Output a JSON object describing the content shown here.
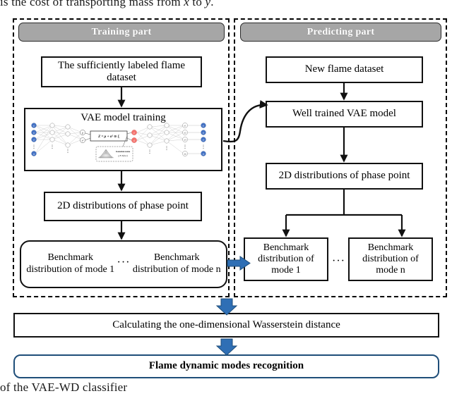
{
  "page": {
    "top_cropped_text_before": "is the cost of transporting mass from ",
    "top_cropped_math_x": "x",
    "top_cropped_text_middle": " to ",
    "top_cropped_math_y": "y",
    "top_cropped_text_after": ".",
    "bottom_cropped_caption": "of the VAE-WD classifier"
  },
  "colors": {
    "header_gray": "#a6a6a6",
    "header_text": "#ffffff",
    "box_border": "#111111",
    "accent_blue": "#2f6fb5",
    "navy_border": "#1f4e79",
    "node_blue": "#4472c4",
    "node_red": "#f4736e"
  },
  "training": {
    "header": "Training part",
    "boxes": {
      "dataset": "The sufficiently labeled flame dataset",
      "vae_title": "VAE model training",
      "distributions": "2D distributions of phase point"
    },
    "vae_figure": {
      "latent_formula": "Z = μ + σ² ⊙ ξ",
      "noise_label": "Gaussian noise",
      "noise_formula": "ξ ∈ N(0,1)",
      "mu_label": "μ",
      "sigma_label": "σ²",
      "input_nodes": [
        "x₁",
        "x₂",
        "x₃",
        "xₙ"
      ],
      "latent_nodes": [
        "z₁",
        "z₂"
      ],
      "output_head_nodes": [
        "ẋ₁",
        "ẋ₂",
        "ẋ₃",
        "ẋₙ"
      ],
      "output_nodes": [
        "ŷ₁",
        "ŷ₂",
        "ŷ₃",
        "ŷₙ"
      ]
    },
    "benchmarks": {
      "first": "Benchmark distribution of mode 1",
      "ellipsis": "···",
      "last": "Benchmark distribution of mode n"
    }
  },
  "predicting": {
    "header": "Predicting part",
    "boxes": {
      "new_dataset": "New flame dataset",
      "well_trained": "Well trained VAE model",
      "distributions": "2D distributions of phase point"
    },
    "benchmarks": {
      "first": "Benchmark distribution of mode 1",
      "ellipsis": "···",
      "last": "Benchmark distribution of mode n"
    }
  },
  "bottom": {
    "wasserstein": "Calculating the one-dimensional Wasserstein distance",
    "result": "Flame dynamic modes recognition"
  }
}
